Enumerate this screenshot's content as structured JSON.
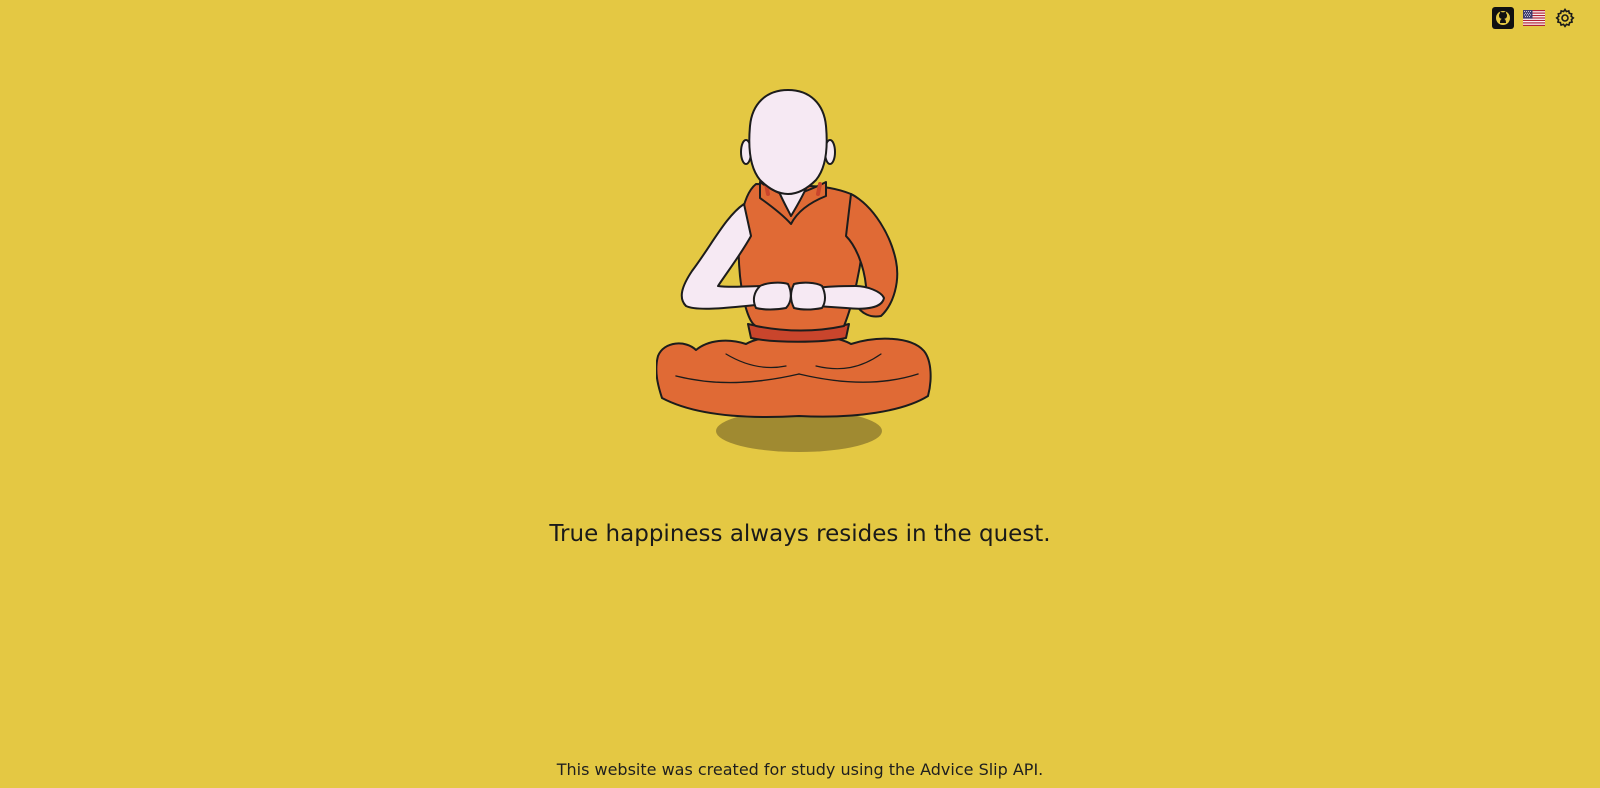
{
  "toolbar": {
    "github_icon": "github-icon",
    "language_icon": "us-flag-icon",
    "settings_icon": "gear-icon"
  },
  "advice": {
    "text": "True happiness always resides in the quest."
  },
  "footer": {
    "text": "This website was created for study using the Advice Slip API."
  },
  "colors": {
    "background": "#e4c843",
    "robe": "#e06a35",
    "skin": "#f6e9f3",
    "shadow": "#a08a31"
  }
}
